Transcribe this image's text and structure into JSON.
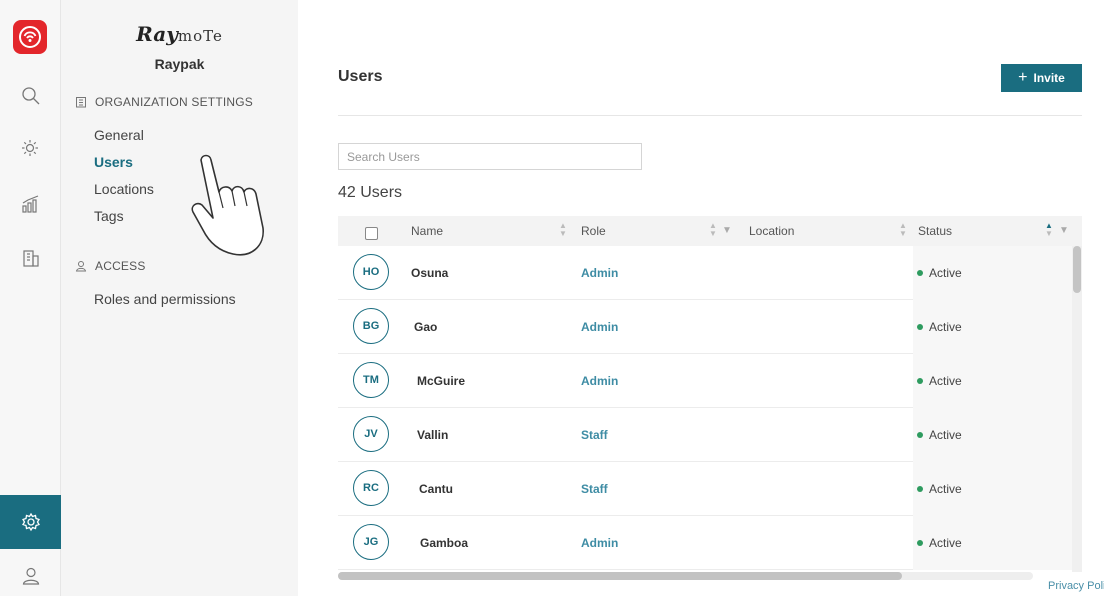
{
  "rail": {
    "items": [
      {
        "icon": "search-icon"
      },
      {
        "icon": "sun-icon"
      },
      {
        "icon": "chart-icon"
      },
      {
        "icon": "building-icon"
      },
      {
        "icon": "gear-icon",
        "active": true
      },
      {
        "icon": "user-icon"
      }
    ]
  },
  "sidebar": {
    "logo_bold": "Ray",
    "logo_thin": "moTe",
    "org_name": "Raypak",
    "org_section": "ORGANIZATION SETTINGS",
    "org_items": [
      "General",
      "Users",
      "Locations",
      "Tags"
    ],
    "active_item": "Users",
    "access_section": "ACCESS",
    "access_items": [
      "Roles and permissions"
    ]
  },
  "main": {
    "title": "Users",
    "invite_label": "Invite",
    "search_placeholder": "Search Users",
    "count_label": "42 Users",
    "columns": {
      "name": "Name",
      "role": "Role",
      "location": "Location",
      "status": "Status"
    },
    "rows": [
      {
        "initials": "HO",
        "name": "Osuna",
        "role": "Admin",
        "location": "",
        "status": "Active"
      },
      {
        "initials": "BG",
        "name": "Gao",
        "role": "Admin",
        "location": "",
        "status": "Active"
      },
      {
        "initials": "TM",
        "name": "McGuire",
        "role": "Admin",
        "location": "",
        "status": "Active"
      },
      {
        "initials": "JV",
        "name": "Vallin",
        "role": "Staff",
        "location": "",
        "status": "Active"
      },
      {
        "initials": "RC",
        "name": "Cantu",
        "role": "Staff",
        "location": "",
        "status": "Active"
      },
      {
        "initials": "JG",
        "name": "Gamboa",
        "role": "Admin",
        "location": "",
        "status": "Active"
      }
    ],
    "privacy_link": "Privacy Polic"
  },
  "colors": {
    "accent": "#1a6d80",
    "brand_red": "#e3262b",
    "role_text": "#3e8ca4",
    "active_dot": "#2e9b5f"
  }
}
